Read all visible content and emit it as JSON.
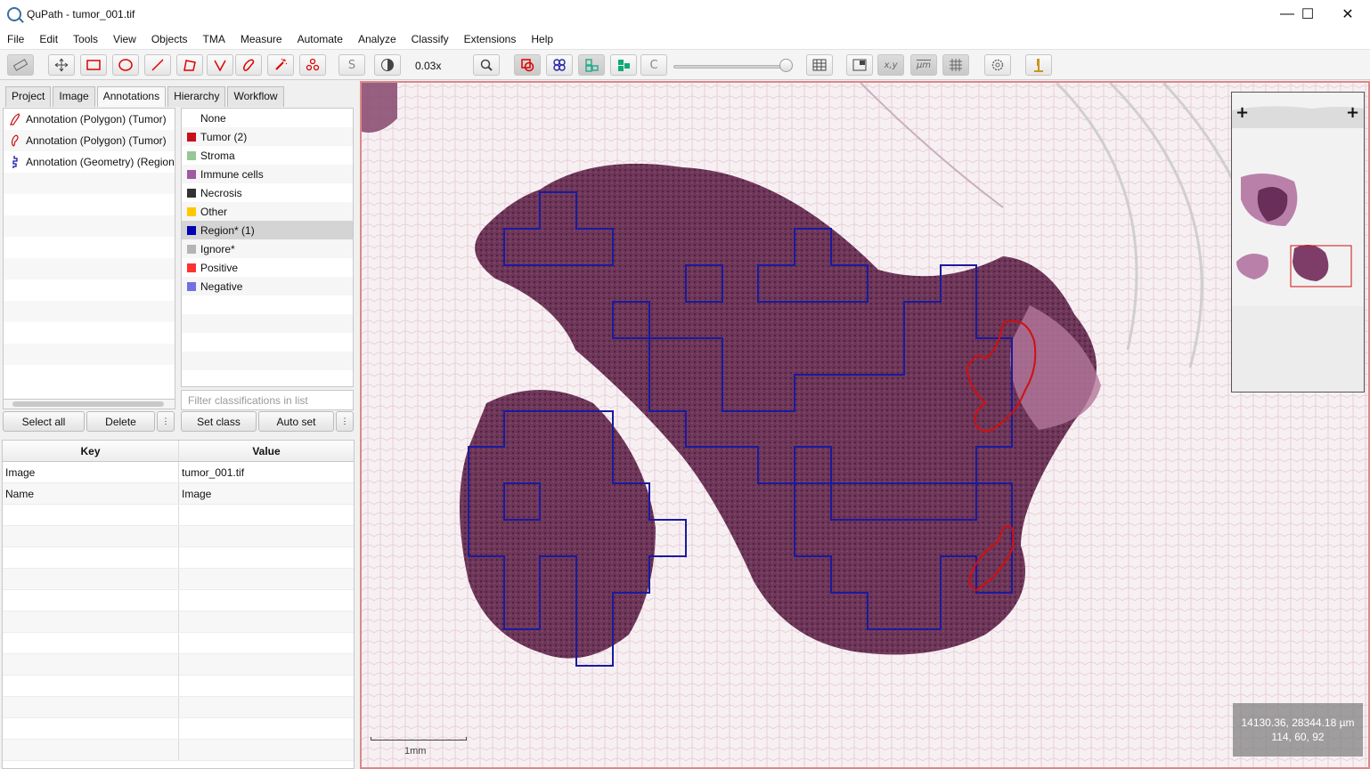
{
  "window": {
    "title": "QuPath - tumor_001.tif",
    "minimize": "—",
    "maximize": "☐",
    "close": "✕"
  },
  "menu": [
    "File",
    "Edit",
    "Tools",
    "View",
    "Objects",
    "TMA",
    "Measure",
    "Automate",
    "Analyze",
    "Classify",
    "Extensions",
    "Help"
  ],
  "toolbar": {
    "zoom": "0.03x",
    "brightness_slider_level": 0.92
  },
  "tabs": [
    "Project",
    "Image",
    "Annotations",
    "Hierarchy",
    "Workflow"
  ],
  "active_tab": "Annotations",
  "annotations": [
    {
      "label": "Annotation (Polygon) (Tumor)",
      "color": "#cc1111",
      "icon": "polygon-icon"
    },
    {
      "label": "Annotation (Polygon) (Tumor)",
      "color": "#cc1111",
      "icon": "polygon-icon"
    },
    {
      "label": "Annotation (Geometry) (Region*",
      "color": "#1111aa",
      "icon": "geometry-icon"
    }
  ],
  "classes": [
    {
      "label": "None",
      "color": ""
    },
    {
      "label": "Tumor (2)",
      "color": "#c8101a"
    },
    {
      "label": "Stroma",
      "color": "#96c896"
    },
    {
      "label": "Immune cells",
      "color": "#a05aa0"
    },
    {
      "label": "Necrosis",
      "color": "#323232"
    },
    {
      "label": "Other",
      "color": "#ffc800"
    },
    {
      "label": "Region* (1)",
      "color": "#0000b4",
      "selected": true
    },
    {
      "label": "Ignore*",
      "color": "#b4b4b4"
    },
    {
      "label": "Positive",
      "color": "#ff3232"
    },
    {
      "label": "Negative",
      "color": "#7070e0"
    }
  ],
  "filter_placeholder": "Filter classifications in list",
  "buttons": {
    "select_all": "Select all",
    "delete": "Delete",
    "more": "⋮",
    "set_class": "Set class",
    "auto_set": "Auto set"
  },
  "table": {
    "headers": [
      "Key",
      "Value"
    ],
    "rows": [
      [
        "Image",
        "tumor_001.tif"
      ],
      [
        "Name",
        "Image"
      ]
    ]
  },
  "viewer": {
    "scale_label": "1mm",
    "coords_line1": "14130.36, 28344.18 µm",
    "coords_line2": "114, 60, 92"
  }
}
